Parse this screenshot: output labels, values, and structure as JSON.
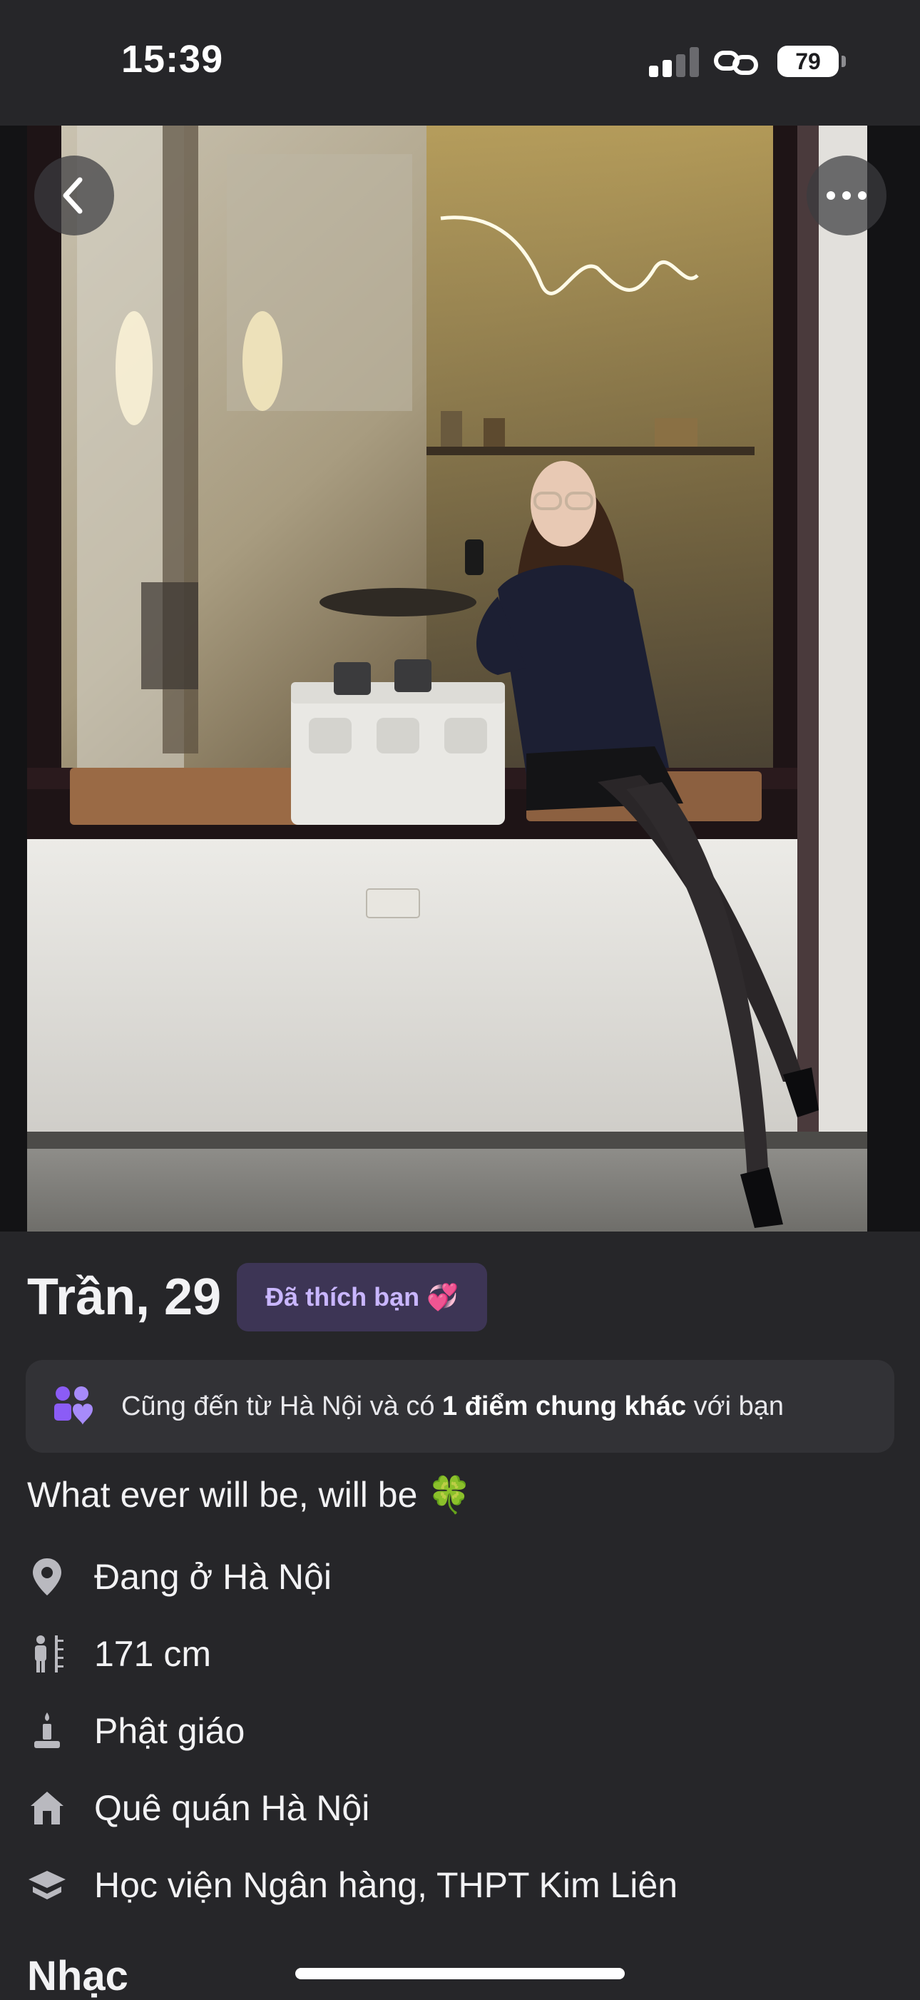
{
  "status_bar": {
    "time": "15:39",
    "battery": "79"
  },
  "photo": {
    "back_icon": "chevron-left-icon",
    "more_icon": "ellipsis-icon"
  },
  "profile": {
    "name_age": "Trần, 29",
    "liked_badge": "Đã thích bạn 💞",
    "common": {
      "prefix": "Cũng đến từ Hà Nội và có ",
      "highlight": "1 điểm chung khác",
      "suffix": " với bạn"
    },
    "bio": "What ever will be, will be 🍀",
    "details": [
      {
        "icon": "location-pin-icon",
        "text": "Đang ở Hà Nội"
      },
      {
        "icon": "height-icon",
        "text": "171 cm"
      },
      {
        "icon": "religion-candle-icon",
        "text": "Phật giáo"
      },
      {
        "icon": "home-icon",
        "text": "Quê quán Hà Nội"
      },
      {
        "icon": "education-cap-icon",
        "text": "Học viện Ngân hàng, THPT Kim Liên"
      }
    ],
    "next_section": "Nhạc"
  },
  "colors": {
    "background": "#262629",
    "card": "#323236",
    "badge_bg": "#3d3555",
    "badge_text": "#c9b6ff",
    "accent": "#8b5cf6"
  }
}
